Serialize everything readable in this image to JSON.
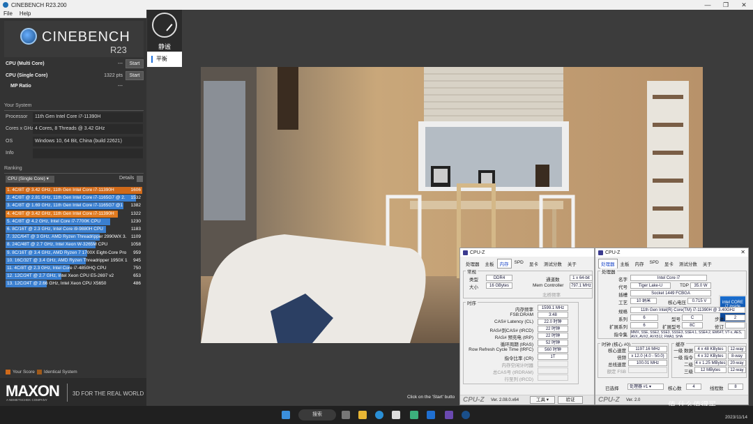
{
  "window": {
    "title": "CINEBENCH R23.200",
    "menu": [
      "File",
      "Help"
    ]
  },
  "logo": {
    "name": "CINEBENCH",
    "version": "R23"
  },
  "tests": [
    {
      "name": "CPU (Multi Core)",
      "value": "---",
      "button": "Start"
    },
    {
      "name": "CPU (Single Core)",
      "value": "1322 pts",
      "button": "Start"
    },
    {
      "name": "MP Ratio",
      "value": "---"
    }
  ],
  "system": {
    "title": "Your System",
    "rows": [
      {
        "k": "Processor",
        "v": "11th Gen Intel Core i7-11390H"
      },
      {
        "k": "Cores x GHz",
        "v": "4 Cores, 8 Threads @ 3.42 GHz"
      },
      {
        "k": "OS",
        "v": "Windows 10, 64 Bit, China (build 22621)"
      },
      {
        "k": "Info",
        "v": ""
      }
    ]
  },
  "ranking": {
    "title": "Ranking",
    "select": "CPU (Single Core)",
    "details": "Details",
    "rows": [
      {
        "label": "1. 4C/8T @ 3.42 GHz, 11th Gen Intel Core i7-11390H",
        "score": "1606",
        "val": 1606,
        "color": "#d06a1a"
      },
      {
        "label": "2. 4C/8T @ 2.81 GHz, 11th Gen Intel Core i7-1165G7 @ 2.",
        "score": "1532",
        "val": 1532,
        "color": "#3a7fd0"
      },
      {
        "label": "3. 4C/8T @ 1.69 GHz, 11th Gen Intel Core i7-1165G7 @1",
        "score": "1382",
        "val": 1382,
        "color": "#3a7fd0"
      },
      {
        "label": "4. 4C/8T @ 3.42 GHz, 11th Gen Intel Core i7-11390H",
        "score": "1322",
        "val": 1322,
        "color": "#e07a1f"
      },
      {
        "label": "5. 4C/8T @ 4.2 GHz, Intel Core i7-7700K CPU",
        "score": "1230",
        "val": 1230,
        "color": "#3a7fd0"
      },
      {
        "label": "6. 8C/16T @ 2.3 GHz, Intel Core i9-9880H CPU",
        "score": "1183",
        "val": 1183,
        "color": "#3a7fd0"
      },
      {
        "label": "7. 32C/64T @ 3 GHz, AMD Ryzen Threadripper 2990WX 3.",
        "score": "1109",
        "val": 1109,
        "color": "#3a7fd0"
      },
      {
        "label": "8. 24C/48T @ 2.7 GHz, Intel Xeon W-3265M CPU",
        "score": "1058",
        "val": 1058,
        "color": "#3a7fd0"
      },
      {
        "label": "9. 8C/16T @ 3.4 GHz, AMD Ryzen 7 1700X Eight-Core Pro",
        "score": "959",
        "val": 959,
        "color": "#3a7fd0"
      },
      {
        "label": "10. 16C/32T @ 3.4 GHz, AMD Ryzen Threadripper 1950X 1",
        "score": "945",
        "val": 945,
        "color": "#3a7fd0"
      },
      {
        "label": "11. 4C/8T @ 2.3 GHz, Intel Core i7-4850HQ CPU",
        "score": "750",
        "val": 750,
        "color": "#3a7fd0"
      },
      {
        "label": "12. 12C/24T @ 2.7 GHz, Intel Xeon CPU E5-2697 v2",
        "score": "653",
        "val": 653,
        "color": "#3a7fd0"
      },
      {
        "label": "13. 12C/24T @ 2.66 GHz, Intel Xeon CPU X5650",
        "score": "486",
        "val": 486,
        "color": "#3a7fd0"
      }
    ],
    "legend_your": "Your Score",
    "legend_ident": "Identical System"
  },
  "brand": {
    "name": "MAXON",
    "sub": "A NEMETSCHEK COMPANY",
    "slogan": "3D FOR THE REAL WORLD"
  },
  "gauge": {
    "label": "静谧",
    "mode": "平衡"
  },
  "status": "Click on the 'Start' butto",
  "cpuz_mem": {
    "title": "CPU-Z",
    "tabs": [
      "处理器",
      "主板",
      "内存",
      "SPD",
      "显卡",
      "测试分数",
      "关于"
    ],
    "active": 2,
    "g1": "常规",
    "type_l": "类型",
    "type": "DDR4",
    "size_l": "大小",
    "size": "16 GBytes",
    "ch_l": "通道数",
    "ch": "1 x 64-bit",
    "mc_l": "Mem Controller",
    "mc": "797.1 MHz",
    "nb_l": "北桥频率",
    "g2": "时序",
    "timings": [
      {
        "k": "内存频率",
        "v": "1599.1 MHz"
      },
      {
        "k": "FSB:DRAM",
        "v": "3:48"
      },
      {
        "k": "CAS# Latency (CL)",
        "v": "22.0 时钟"
      },
      {
        "k": "RAS#到CAS# (tRCD)",
        "v": "22 时钟"
      },
      {
        "k": "RAS# 预充电 (tRP)",
        "v": "22 时钟"
      },
      {
        "k": "循环周期 (tRAS)",
        "v": "52 时钟"
      },
      {
        "k": "Row Refresh Cycle Time (tRFC)",
        "v": "560 时钟"
      },
      {
        "k": "指令比率 (CR)",
        "v": "1T"
      },
      {
        "k": "内存空闲计时器",
        "v": ""
      },
      {
        "k": "总CAS号 (tRDRAM)",
        "v": ""
      },
      {
        "k": "行至列 (tRCD)",
        "v": ""
      }
    ],
    "brand": "CPU-Z",
    "ver": "Ver. 2.08.0.x64",
    "tools": "工具",
    "verify": "验证"
  },
  "cpuz_cpu": {
    "title": "CPU-Z",
    "tabs": [
      "处理器",
      "主板",
      "内存",
      "SPD",
      "显卡",
      "测试分数",
      "关于"
    ],
    "active": 0,
    "g1": "处理器",
    "name_l": "名字",
    "name": "Intel Core i7",
    "code_l": "代号",
    "code": "Tiger Lake-U",
    "tdp_l": "TDP",
    "tdp": "35.0 W",
    "sock_l": "插槽",
    "sock": "Socket 1449 FCBGA",
    "proc_l": "工艺",
    "proc": "10 纳米",
    "volt_l": "核心电压",
    "volt": "0.715 V",
    "spec_l": "规格",
    "spec": "11th Gen Intel(R) Core(TM) i7-11390H @ 3.40GHz",
    "fam_l": "系列",
    "fam": "6",
    "model_l": "型号",
    "model": "C",
    "step_l": "步进",
    "step": "2",
    "efam_l": "扩展系列",
    "efam": "6",
    "emod_l": "扩展型号",
    "emod": "8C",
    "rev_l": "修订",
    "rev": "",
    "ins_l": "指令集",
    "ins": "MMX, SSE, SSE2, SSE3, SSSE3, SSE4.1, SSE4.2, EM64T, VT-x, AES, AVX, AVX2, AVX512, FMA3, SHA",
    "g2": "时钟 (核心 #0)",
    "clk": [
      {
        "k": "核心速度",
        "v": "1197.16 MHz"
      },
      {
        "k": "倍频",
        "v": "x 12.0 (4.0 - 50.0)"
      },
      {
        "k": "总线速度",
        "v": "100.01 MHz"
      },
      {
        "k": "额定 FSB",
        "v": ""
      }
    ],
    "g3": "缓存",
    "cache": [
      {
        "k": "一级 数据",
        "v": "4 x 48 KBytes",
        "w": "12-way"
      },
      {
        "k": "一级 指令",
        "v": "4 x 32 KBytes",
        "w": "8-way"
      },
      {
        "k": "二级",
        "v": "4 x 1.25 MBytes",
        "w": "20-way"
      },
      {
        "k": "三级",
        "v": "12 MBytes",
        "w": "12-way"
      }
    ],
    "sel_l": "已选择",
    "sel": "处理器 #1",
    "cores_l": "核心数",
    "cores": "4",
    "thr_l": "线程数",
    "thr": "8",
    "intel": "intel CORE i7 inside",
    "brand": "CPU-Z",
    "ver": "Ver. 2.0"
  },
  "taskbar": {
    "search": "搜索",
    "date": "2023/11/14"
  },
  "watermark": "值 什么值得买"
}
